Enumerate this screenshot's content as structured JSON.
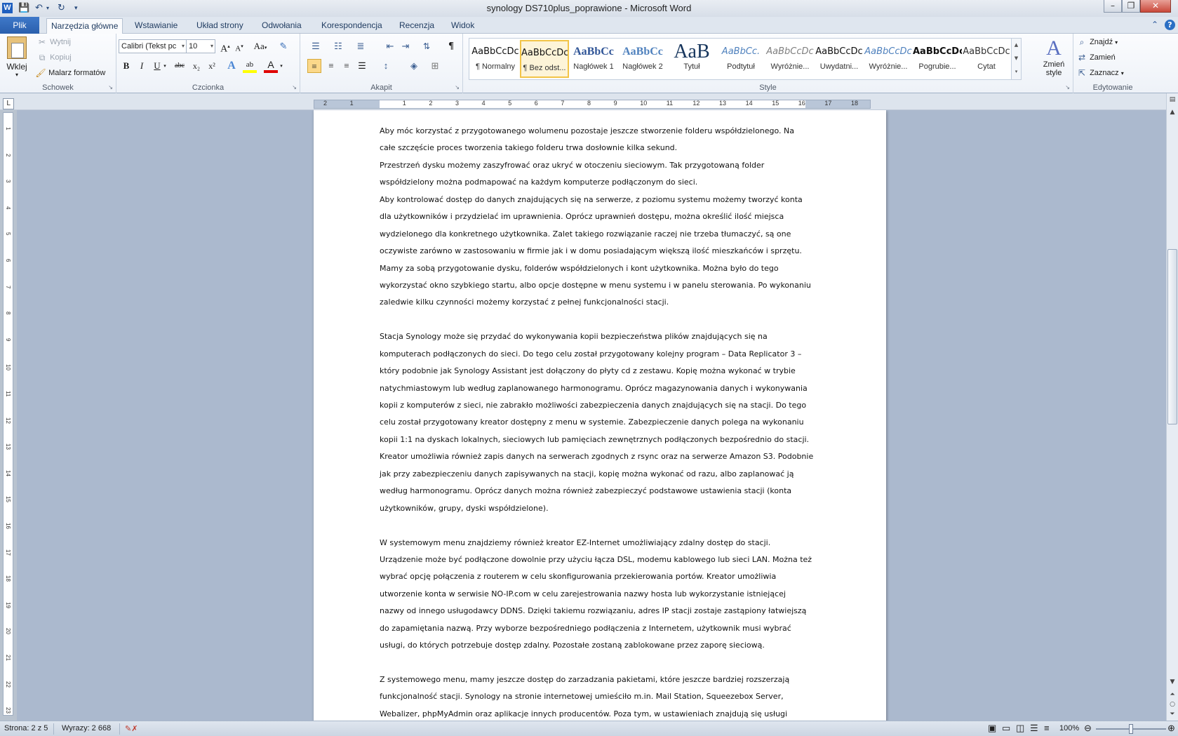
{
  "titlebar": {
    "title": "synology DS710plus_poprawione  -  Microsoft Word",
    "app_icon": "W",
    "qat": [
      "save-icon",
      "undo-icon",
      "redo-icon",
      "customize-icon"
    ],
    "minimize": "–",
    "restore": "❐",
    "close": "✕"
  },
  "tabs": {
    "file": "Plik",
    "items": [
      "Narzędzia główne",
      "Wstawianie",
      "Układ strony",
      "Odwołania",
      "Korespondencja",
      "Recenzja",
      "Widok"
    ],
    "active": "Narzędzia główne"
  },
  "ribbon": {
    "clipboard": {
      "label": "Schowek",
      "paste": "Wklej",
      "cut": "Wytnij",
      "copy": "Kopiuj",
      "format_painter": "Malarz formatów"
    },
    "font": {
      "label": "Czcionka",
      "name": "Calibri (Tekst pc",
      "size": "10",
      "grow": "A",
      "shrink": "A",
      "case": "Aa",
      "clear": "✎",
      "bold": "B",
      "italic": "I",
      "underline": "U",
      "strike": "abc",
      "sub": "x₂",
      "sup": "x²",
      "effects": "A",
      "highlight": "ab",
      "color": "A"
    },
    "paragraph": {
      "label": "Akapit"
    },
    "styles": {
      "label": "Style",
      "items": [
        {
          "preview": "AaBbCcDc",
          "name": "¶ Normalny",
          "color": "#111111"
        },
        {
          "preview": "AaBbCcDc",
          "name": "¶ Bez odst...",
          "color": "#111111",
          "active": true
        },
        {
          "preview": "AaBbCc",
          "name": "Nagłówek 1",
          "color": "#2f5496"
        },
        {
          "preview": "AaBbCc",
          "name": "Nagłówek 2",
          "color": "#4f81bd"
        },
        {
          "preview": "AaB",
          "name": "Tytuł",
          "color": "#17365d"
        },
        {
          "preview": "AaBbCc.",
          "name": "Podtytuł",
          "color": "#4f81bd"
        },
        {
          "preview": "AaBbCcDc",
          "name": "Wyróżnie...",
          "color": "#7f7f7f"
        },
        {
          "preview": "AaBbCcDc",
          "name": "Uwydatni...",
          "color": "#111111"
        },
        {
          "preview": "AaBbCcDc",
          "name": "Wyróżnie...",
          "color": "#4f81bd"
        },
        {
          "preview": "AaBbCcDc",
          "name": "Pogrubie...",
          "color": "#111111"
        },
        {
          "preview": "AaBbCcDc",
          "name": "Cytat",
          "color": "#333333"
        }
      ],
      "change_styles": "Zmień style"
    },
    "editing": {
      "label": "Edytowanie",
      "find": "Znajdź",
      "replace": "Zamień",
      "select": "Zaznacz"
    }
  },
  "ruler": {
    "numbers": [
      "2",
      "1",
      "",
      "1",
      "2",
      "3",
      "4",
      "5",
      "6",
      "7",
      "8",
      "9",
      "10",
      "11",
      "12",
      "13",
      "14",
      "15",
      "16",
      "17",
      "18"
    ],
    "vertical": [
      "1",
      "2",
      "3",
      "4",
      "5",
      "6",
      "7",
      "8",
      "9",
      "10",
      "11",
      "12",
      "13",
      "14",
      "15",
      "16",
      "17",
      "18",
      "19",
      "20",
      "21",
      "22",
      "23"
    ]
  },
  "document": {
    "lines": [
      "Aby móc korzystać z przygotowanego wolumenu pozostaje jeszcze stworzenie folderu współdzielonego. Na",
      "całe szczęście proces tworzenia takiego folderu trwa dosłownie kilka sekund.",
      "Przestrzeń dysku możemy zaszyfrować oraz ukryć w otoczeniu sieciowym. Tak przygotowaną folder",
      "współdzielony można podmapować na każdym komputerze podłączonym do sieci.",
      "Aby kontrolować dostęp do danych znajdujących się na serwerze, z poziomu systemu możemy tworzyć konta",
      "dla użytkowników i przydzielać im uprawnienia. Oprócz uprawnień dostępu, można określić ilość miejsca",
      "wydzielonego dla konkretnego użytkownika. Zalet takiego rozwiązanie raczej nie trzeba tłumaczyć, są one",
      "oczywiste zarówno w zastosowaniu w firmie jak i w domu posiadającym większą ilość mieszkańców i sprzętu.",
      "Mamy za sobą przygotowanie dysku, folderów współdzielonych i kont użytkownika. Można było do tego",
      "wykorzystać okno szybkiego startu, albo opcje dostępne w menu systemu i w panelu sterowania. Po wykonaniu",
      "zaledwie kilku czynności możemy korzystać z pełnej funkcjonalności stacji.",
      "",
      "Stacja Synology może się przydać do wykonywania kopii bezpieczeństwa plików znajdujących się na",
      "komputerach podłączonych do sieci. Do tego celu został przygotowany kolejny program – Data Replicator 3 –",
      "który podobnie jak Synology Assistant jest dołączony do płyty cd z zestawu. Kopię można wykonać w trybie",
      "natychmiastowym lub według zaplanowanego harmonogramu. Oprócz magazynowania danych i wykonywania",
      "kopii z komputerów z sieci, nie zabrakło możliwości zabezpieczenia danych znajdujących się na stacji. Do tego",
      "celu został przygotowany kreator dostępny z menu w systemie. Zabezpieczenie danych polega na wykonaniu",
      "kopii 1:1 na dyskach lokalnych, sieciowych lub pamięciach zewnętrznych podłączonych bezpośrednio do stacji.",
      "Kreator umożliwia również zapis danych na serwerach zgodnych z rsync oraz na serwerze Amazon S3. Podobnie",
      "jak przy zabezpieczeniu danych zapisywanych na stacji, kopię można wykonać od razu, albo zaplanować ją",
      "według harmonogramu. Oprócz danych można również zabezpieczyć podstawowe ustawienia stacji (konta",
      "użytkowników, grupy, dyski współdzielone).",
      "",
      "W systemowym menu znajdziemy również kreator EZ-Internet umożliwiający zdalny dostęp do stacji.",
      "Urządzenie może być podłączone dowolnie przy użyciu łącza DSL, modemu kablowego lub sieci LAN. Można też",
      "wybrać opcję połączenia z routerem w celu skonfigurowania przekierowania portów. Kreator umożliwia",
      "utworzenie konta w serwisie NO-IP.com w celu zarejestrowania nazwy hosta lub wykorzystanie istniejącej",
      "nazwy od innego usługodawcy DDNS. Dzięki takiemu rozwiązaniu, adres IP stacji zostaje zastąpiony łatwiejszą",
      "do zapamiętania nazwą. Przy wyborze bezpośredniego podłączenia z Internetem, użytkownik musi wybrać",
      "usługi, do których potrzebuje dostęp zdalny. Pozostałe zostaną zablokowane przez zaporę sieciową.",
      "",
      "Z systemowego menu, mamy jeszcze dostęp do zarzadzania pakietami, które jeszcze bardziej rozszerzają",
      "funkcjonalność stacji. Synology na stronie internetowej umieściło m.in. Mail Station, Squeezebox Server,",
      "Webalizer, phpMyAdmin oraz aplikacje innych producentów. Poza tym, w ustawieniach znajdują się usługi"
    ]
  },
  "statusbar": {
    "page": "Strona: 2 z 5",
    "words": "Wyrazy: 2 668",
    "zoom": "100%",
    "zoom_level": 1.0
  }
}
